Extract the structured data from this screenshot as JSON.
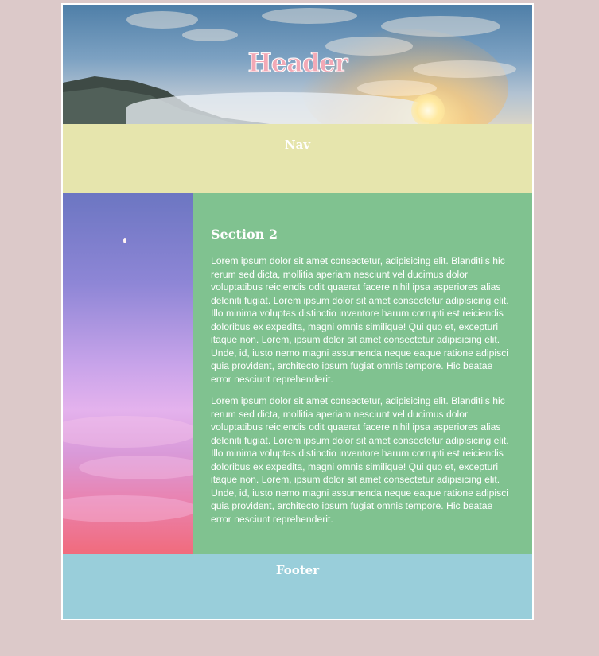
{
  "header": {
    "title": "Header"
  },
  "nav": {
    "title": "Nav"
  },
  "section": {
    "title": "Section 2",
    "paragraphs": [
      "Lorem ipsum dolor sit amet consectetur, adipisicing elit. Blanditiis hic rerum sed dicta, mollitia aperiam nesciunt vel ducimus dolor voluptatibus reiciendis odit quaerat facere nihil ipsa asperiores alias deleniti fugiat. Lorem ipsum dolor sit amet consectetur adipisicing elit. Illo minima voluptas distinctio inventore harum corrupti est reiciendis doloribus ex expedita, magni omnis similique! Qui quo et, excepturi itaque non. Lorem, ipsum dolor sit amet consectetur adipisicing elit. Unde, id, iusto nemo magni assumenda neque eaque ratione adipisci quia provident, architecto ipsum fugiat omnis tempore. Hic beatae error nesciunt reprehenderit.",
      "Lorem ipsum dolor sit amet consectetur, adipisicing elit. Blanditiis hic rerum sed dicta, mollitia aperiam nesciunt vel ducimus dolor voluptatibus reiciendis odit quaerat facere nihil ipsa asperiores alias deleniti fugiat. Lorem ipsum dolor sit amet consectetur adipisicing elit. Illo minima voluptas distinctio inventore harum corrupti est reiciendis doloribus ex expedita, magni omnis similique! Qui quo et, excepturi itaque non. Lorem, ipsum dolor sit amet consectetur adipisicing elit. Unde, id, iusto nemo magni assumenda neque eaque ratione adipisci quia provident, architecto ipsum fugiat omnis tempore. Hic beatae error nesciunt reprehenderit."
    ]
  },
  "footer": {
    "title": "Footer"
  },
  "colors": {
    "page_background": "#dcc9c9",
    "header_title": "#f2a9b6",
    "nav_background": "#e6e5ad",
    "content_background": "#80c290",
    "footer_background": "#99ceda"
  }
}
